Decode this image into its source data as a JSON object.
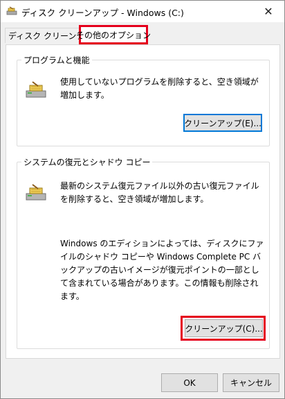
{
  "window": {
    "title": "ディスク クリーンアップ - Windows (C:)",
    "close_symbol": "✕"
  },
  "tabs": [
    {
      "label": "ディスク クリーンアップ",
      "selected": false
    },
    {
      "label": "その他のオプション",
      "selected": true,
      "highlighted": true
    }
  ],
  "programs_group": {
    "label": "プログラムと機能",
    "icon": "disk-cleanup-icon",
    "description": "使用していないプログラムを削除すると、空き領域が増加します。",
    "button_label": "クリーンアップ(E)..."
  },
  "restore_group": {
    "label": "システムの復元とシャドウ コピー",
    "icon": "disk-cleanup-icon",
    "description_1": "最新のシステム復元ファイル以外の古い復元ファイルを削除すると、空き領域が増加します。",
    "description_2": "Windows のエディションによっては、ディスクにファイルのシャドウ コピーや Windows Complete PC バックアップの古いイメージが復元ポイントの一部として含まれている場合があります。この情報も削除されます。",
    "button_label": "クリーンアップ(C)..."
  },
  "footer": {
    "ok_label": "OK",
    "cancel_label": "キャンセル"
  },
  "colors": {
    "highlight": "#e5001c",
    "default_button_border": "#0078d7"
  }
}
